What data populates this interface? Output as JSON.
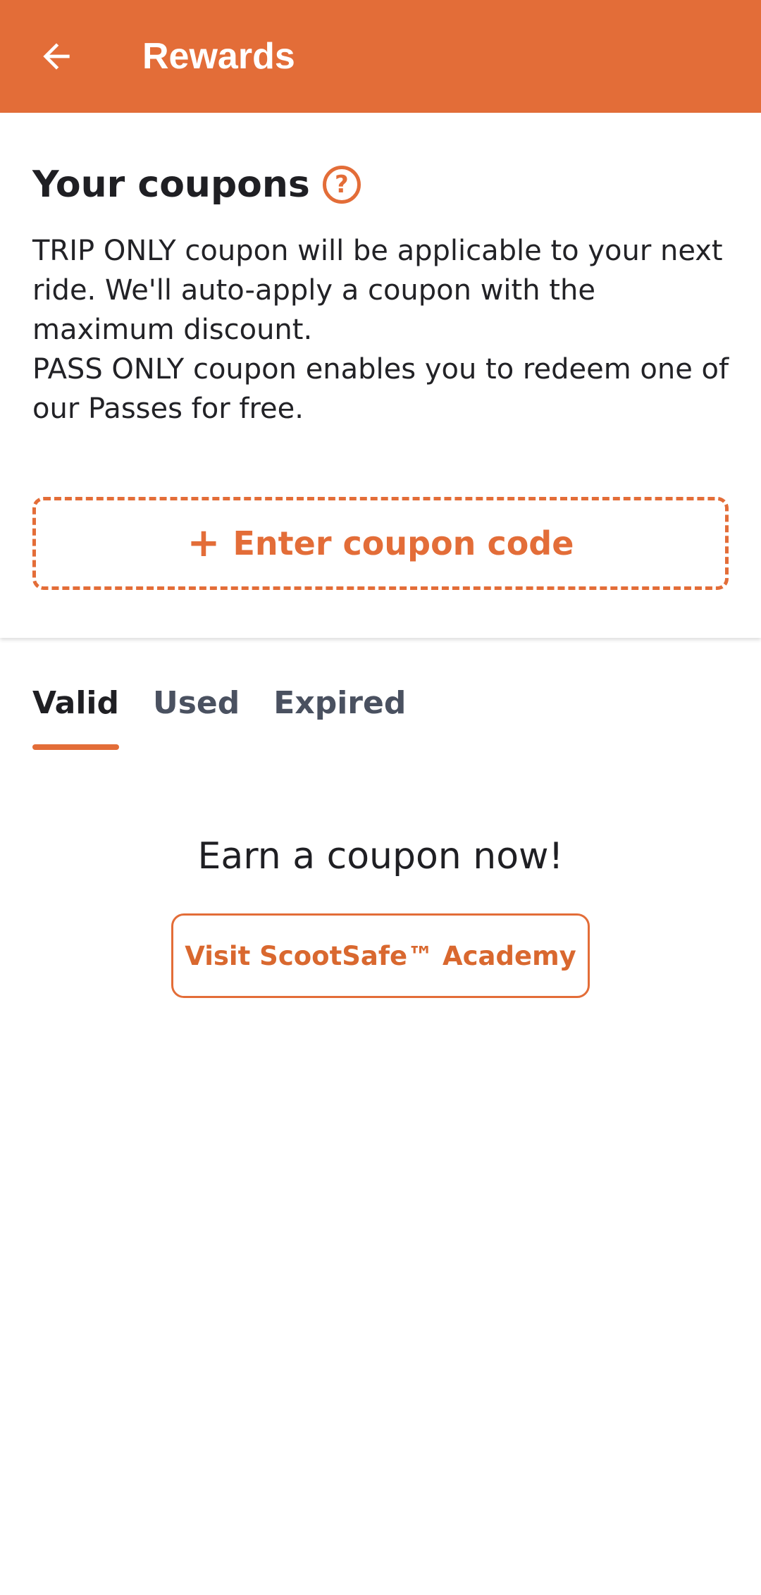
{
  "app_bar": {
    "title": "Rewards",
    "back_icon": "arrow-left-icon",
    "background_color": "#e36d38"
  },
  "coupons": {
    "title": "Your coupons",
    "help_icon": "question-circle-icon",
    "help_glyph": "?",
    "description_line_1": "TRIP ONLY coupon will be applicable to your next ride. We'll auto-apply a coupon with the maximum discount.",
    "description_line_2": "PASS ONLY coupon enables you to redeem one of our Passes for free.",
    "enter_code_icon": "plus-icon",
    "enter_code_plus": "+",
    "enter_code_label": "Enter coupon code"
  },
  "tabs": [
    {
      "label": "Valid",
      "active": true
    },
    {
      "label": "Used",
      "active": false
    },
    {
      "label": "Expired",
      "active": false
    }
  ],
  "empty_state": {
    "title": "Earn a coupon now!",
    "button_label": "Visit ScootSafe™ Academy"
  },
  "colors": {
    "accent": "#e36d38",
    "text_primary": "#1f1f23",
    "tab_inactive": "#4a5160"
  }
}
